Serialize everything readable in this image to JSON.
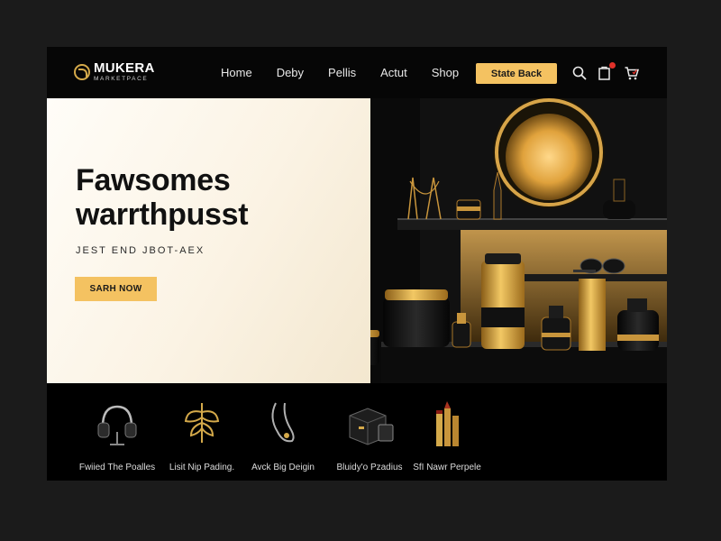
{
  "brand": {
    "name": "MUKERA",
    "tagline": "MARKETPACE"
  },
  "nav": [
    {
      "label": "Home"
    },
    {
      "label": "Deby"
    },
    {
      "label": "Pellis"
    },
    {
      "label": "Actut"
    },
    {
      "label": "Shop"
    }
  ],
  "header": {
    "cta_label": "State Back",
    "icons": [
      "search-icon",
      "bag-icon",
      "cart-icon"
    ],
    "accent": "#f4c261",
    "notification_color": "#e0312a"
  },
  "hero": {
    "title_line1": "Fawsomes",
    "title_line2": "warrthpusst",
    "subtitle": "JEST END JBOT-AEX",
    "button_label": "SARH NOW"
  },
  "categories": [
    {
      "label": "Fwiied The Poalles",
      "icon": "headphones-icon"
    },
    {
      "label": "Lisit Nip Pading.",
      "icon": "pendant-icon"
    },
    {
      "label": "Avck Big Deigin",
      "icon": "necklace-icon"
    },
    {
      "label": "Bluidy'o Pzadius",
      "icon": "box-icon"
    },
    {
      "label": "SfI Nawr Perpele",
      "icon": "lipstick-icon"
    }
  ],
  "colors": {
    "gold": "#d4a94a",
    "dark": "#050505"
  }
}
